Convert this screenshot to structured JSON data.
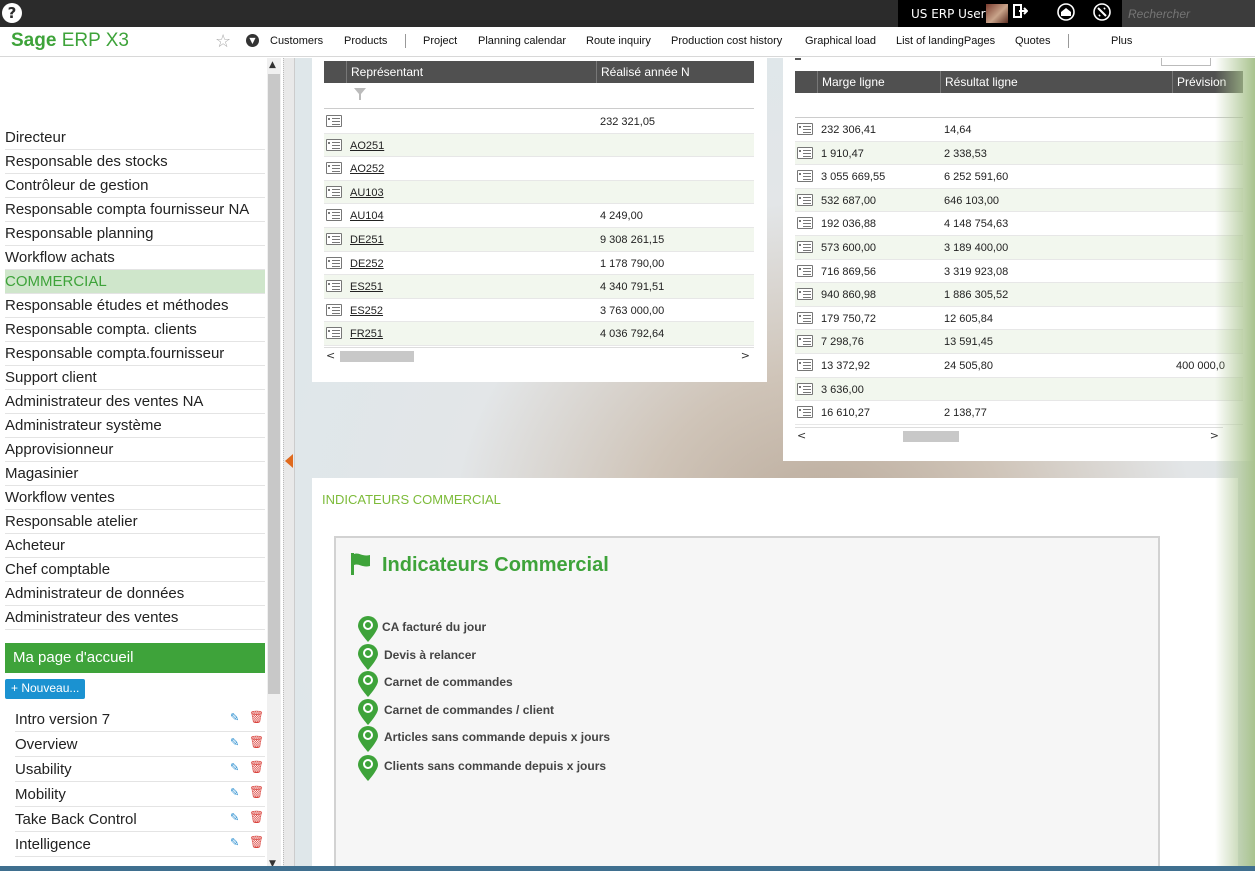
{
  "topbar": {
    "help_icon": "?",
    "user_name": "US ERP User",
    "search_placeholder": "Rechercher"
  },
  "navbar": {
    "logo_brand": "Sage",
    "logo_product": "ERP X3",
    "links": [
      "Customers",
      "Products",
      "Project",
      "Planning calendar",
      "Route inquiry",
      "Production cost history",
      "Graphical load",
      "List of landingPages",
      "Quotes",
      "Plus"
    ]
  },
  "sidebar": {
    "roles": [
      "Directeur",
      "Responsable des stocks",
      "Contrôleur de gestion",
      "Responsable compta fournisseur NA",
      "Responsable planning",
      "Workflow achats",
      "COMMERCIAL",
      "Responsable études et méthodes",
      "Responsable compta. clients",
      "Responsable compta.fournisseur",
      "Support client",
      "Administrateur des ventes NA",
      "Administrateur système",
      "Approvisionneur",
      "Magasinier",
      "Workflow ventes",
      "Responsable atelier",
      "Acheteur",
      "Chef comptable",
      "Administrateur de données",
      "Administrateur des ventes"
    ],
    "active_role": "COMMERCIAL",
    "homepage_title": "Ma page d'accueil",
    "new_button": "+ Nouveau...",
    "homepages": [
      "Intro version 7",
      "Overview",
      "Usability",
      "Mobility",
      "Take Back Control",
      "Intelligence"
    ]
  },
  "grid_left": {
    "columns": [
      "Représentant",
      "Réalisé année N"
    ],
    "rows": [
      {
        "code": "",
        "value": "232 321,05"
      },
      {
        "code": "AO251",
        "value": ""
      },
      {
        "code": "AO252",
        "value": ""
      },
      {
        "code": "AU103",
        "value": ""
      },
      {
        "code": "AU104",
        "value": "4 249,00"
      },
      {
        "code": "DE251",
        "value": "9 308 261,15"
      },
      {
        "code": "DE252",
        "value": "1 178 790,00"
      },
      {
        "code": "ES251",
        "value": "4 340 791,51"
      },
      {
        "code": "ES252",
        "value": "3 763 000,00"
      },
      {
        "code": "FR251",
        "value": "4 036 792,64"
      }
    ]
  },
  "grid_right": {
    "columns": [
      "Marge ligne",
      "Résultat ligne",
      "Prévision"
    ],
    "rows": [
      {
        "marge": "232 306,41",
        "resultat": "14,64",
        "prevision": ""
      },
      {
        "marge": "1 910,47",
        "resultat": "2 338,53",
        "prevision": ""
      },
      {
        "marge": "3 055 669,55",
        "resultat": "6 252 591,60",
        "prevision": ""
      },
      {
        "marge": "532 687,00",
        "resultat": "646 103,00",
        "prevision": ""
      },
      {
        "marge": "192 036,88",
        "resultat": "4 148 754,63",
        "prevision": ""
      },
      {
        "marge": "573 600,00",
        "resultat": "3 189 400,00",
        "prevision": ""
      },
      {
        "marge": "716 869,56",
        "resultat": "3 319 923,08",
        "prevision": ""
      },
      {
        "marge": "940 860,98",
        "resultat": "1 886 305,52",
        "prevision": ""
      },
      {
        "marge": "179 750,72",
        "resultat": "12 605,84",
        "prevision": ""
      },
      {
        "marge": "7 298,76",
        "resultat": "13 591,45",
        "prevision": ""
      },
      {
        "marge": "13 372,92",
        "resultat": "24 505,80",
        "prevision": "400 000,0"
      },
      {
        "marge": "3 636,00",
        "resultat": "",
        "prevision": ""
      },
      {
        "marge": "16 610,27",
        "resultat": "2 138,77",
        "prevision": ""
      }
    ]
  },
  "indicators": {
    "section_title": "INDICATEURS COMMERCIAL",
    "box_title": "Indicateurs Commercial",
    "items": [
      "CA facturé du jour",
      "Devis à relancer",
      "Carnet de commandes",
      "Carnet de commandes / client",
      "Articles sans commande depuis x jours",
      "Clients sans commande depuis x jours"
    ]
  },
  "colors": {
    "brand_green": "#3ea33a",
    "active_role_bg": "#cfe6cb",
    "new_button": "#1b92d1",
    "grid_header": "#505050",
    "splitter_arrow": "#e06a1d"
  },
  "icons": [
    "help-icon",
    "logout-icon",
    "home-icon",
    "disconnect-icon",
    "star-icon",
    "chevron-down-icon",
    "edit-icon",
    "trash-icon",
    "filter-icon",
    "row-detail-icon",
    "flag-icon",
    "map-pin-icon"
  ]
}
